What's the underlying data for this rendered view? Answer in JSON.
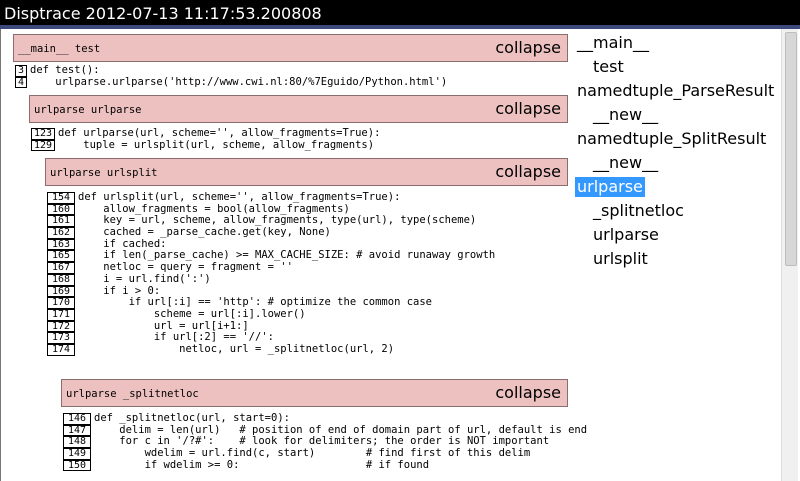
{
  "window": {
    "title": "Disptrace 2012-07-13 11:17:53.200808"
  },
  "collapse_label": "collapse",
  "blocks": [
    {
      "name": "__main__ test",
      "lines": [
        {
          "n": "3",
          "t": "def test():"
        },
        {
          "n": "4",
          "t": "    urlparse.urlparse('http://www.cwi.nl:80/%7Eguido/Python.html')"
        }
      ]
    },
    {
      "name": "urlparse urlparse",
      "lines": [
        {
          "n": "123",
          "t": "def urlparse(url, scheme='', allow_fragments=True):"
        },
        {
          "n": "129",
          "t": "    tuple = urlsplit(url, scheme, allow_fragments)"
        }
      ]
    },
    {
      "name": "urlparse urlsplit",
      "lines": [
        {
          "n": "154",
          "t": "def urlsplit(url, scheme='', allow_fragments=True):"
        },
        {
          "n": "160",
          "t": "    allow_fragments = bool(allow_fragments)"
        },
        {
          "n": "161",
          "t": "    key = url, scheme, allow_fragments, type(url), type(scheme)"
        },
        {
          "n": "162",
          "t": "    cached = _parse_cache.get(key, None)"
        },
        {
          "n": "163",
          "t": "    if cached:"
        },
        {
          "n": "165",
          "t": "    if len(_parse_cache) >= MAX_CACHE_SIZE: # avoid runaway growth"
        },
        {
          "n": "167",
          "t": "    netloc = query = fragment = ''"
        },
        {
          "n": "168",
          "t": "    i = url.find(':')"
        },
        {
          "n": "169",
          "t": "    if i > 0:"
        },
        {
          "n": "170",
          "t": "        if url[:i] == 'http': # optimize the common case"
        },
        {
          "n": "171",
          "t": "            scheme = url[:i].lower()"
        },
        {
          "n": "172",
          "t": "            url = url[i+1:]"
        },
        {
          "n": "173",
          "t": "            if url[:2] == '//':"
        },
        {
          "n": "174",
          "t": "                netloc, url = _splitnetloc(url, 2)"
        }
      ]
    },
    {
      "name": "urlparse _splitnetloc",
      "lines": [
        {
          "n": "146",
          "t": "def _splitnetloc(url, start=0):"
        },
        {
          "n": "147",
          "t": "    delim = len(url)   # position of end of domain part of url, default is end"
        },
        {
          "n": "148",
          "t": "    for c in '/?#':    # look for delimiters; the order is NOT important"
        },
        {
          "n": "149",
          "t": "        wdelim = url.find(c, start)        # find first of this delim"
        },
        {
          "n": "150",
          "t": "        if wdelim >= 0:                    # if found"
        }
      ]
    }
  ],
  "sidebar": {
    "items": [
      {
        "label": "__main__"
      },
      {
        "label": "test"
      },
      {
        "label": "namedtuple_ParseResult"
      },
      {
        "label": "__new__"
      },
      {
        "label": "namedtuple_SplitResult"
      },
      {
        "label": "__new__"
      },
      {
        "label": "urlparse"
      },
      {
        "label": "_splitnetloc"
      },
      {
        "label": "urlparse"
      },
      {
        "label": "urlsplit"
      }
    ]
  },
  "colors": {
    "header_bg": "#eec1c1",
    "selection": "#3399ff",
    "titlebar": "#000000"
  }
}
